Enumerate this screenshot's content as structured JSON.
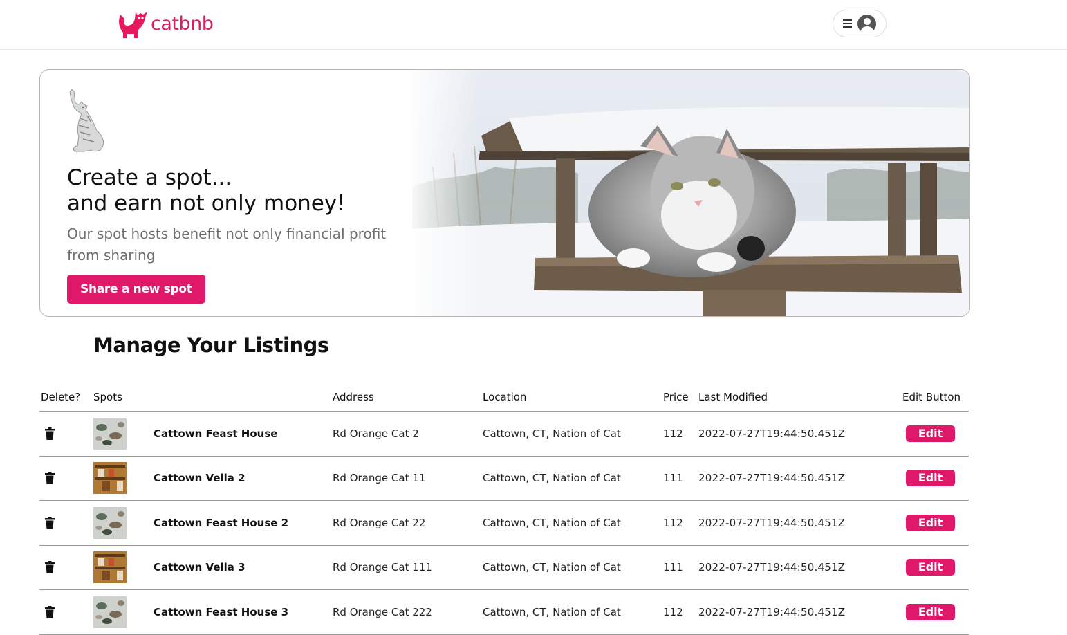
{
  "header": {
    "logo_text": "catbnb"
  },
  "hero": {
    "title_line1": "Create a spot...",
    "title_line2": "and earn not only money!",
    "subtitle": "Our spot hosts benefit not only financial profit from sharing",
    "cta_label": "Share a new spot"
  },
  "listings": {
    "title": "Manage Your Listings",
    "columns": {
      "delete": "Delete?",
      "spots": "Spots",
      "address": "Address",
      "location": "Location",
      "price": "Price",
      "modified": "Last Modified",
      "edit": "Edit Button"
    },
    "rows": [
      {
        "name": "Cattown Feast House",
        "address": "Rd Orange Cat 2",
        "location": "Cattown, CT, Nation of Cat",
        "price": "112",
        "modified": "2022-07-27T19:44:50.451Z",
        "edit_label": "Edit",
        "thumb": "birds"
      },
      {
        "name": "Cattown Vella 2",
        "address": "Rd Orange Cat 11",
        "location": "Cattown, CT, Nation of Cat",
        "price": "111",
        "modified": "2022-07-27T19:44:50.451Z",
        "edit_label": "Edit",
        "thumb": "shelf"
      },
      {
        "name": "Cattown Feast House 2",
        "address": "Rd Orange Cat 22",
        "location": "Cattown, CT, Nation of Cat",
        "price": "112",
        "modified": "2022-07-27T19:44:50.451Z",
        "edit_label": "Edit",
        "thumb": "birds"
      },
      {
        "name": "Cattown Vella 3",
        "address": "Rd Orange Cat 111",
        "location": "Cattown, CT, Nation of Cat",
        "price": "111",
        "modified": "2022-07-27T19:44:50.451Z",
        "edit_label": "Edit",
        "thumb": "shelf"
      },
      {
        "name": "Cattown Feast House 3",
        "address": "Rd Orange Cat 222",
        "location": "Cattown, CT, Nation of Cat",
        "price": "112",
        "modified": "2022-07-27T19:44:50.451Z",
        "edit_label": "Edit",
        "thumb": "birds"
      }
    ]
  },
  "colors": {
    "brand": "#e5195f",
    "button": "#e0186a"
  },
  "icons": {
    "logo": "cat-logo-icon",
    "menu": "hamburger-icon",
    "avatar": "user-avatar-icon",
    "delete": "trash-icon"
  }
}
